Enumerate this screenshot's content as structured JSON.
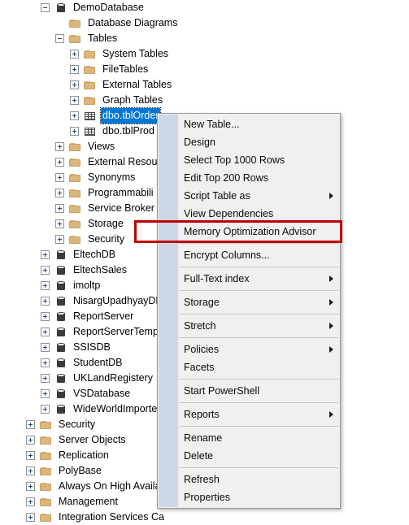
{
  "tree": {
    "name": "object-explorer-tree",
    "items": [
      {
        "label": "DemoDatabase",
        "indent": 2,
        "icon": "database-icon",
        "expander": "minus",
        "selected": false
      },
      {
        "label": "Database Diagrams",
        "indent": 3,
        "icon": "folder-icon",
        "expander": "none",
        "selected": false
      },
      {
        "label": "Tables",
        "indent": 3,
        "icon": "folder-icon",
        "expander": "minus",
        "selected": false
      },
      {
        "label": "System Tables",
        "indent": 4,
        "icon": "folder-icon",
        "expander": "plus",
        "selected": false
      },
      {
        "label": "FileTables",
        "indent": 4,
        "icon": "folder-icon",
        "expander": "plus",
        "selected": false
      },
      {
        "label": "External Tables",
        "indent": 4,
        "icon": "folder-icon",
        "expander": "plus",
        "selected": false
      },
      {
        "label": "Graph Tables",
        "indent": 4,
        "icon": "folder-icon",
        "expander": "plus",
        "selected": false
      },
      {
        "label": "dbo.tblOrder",
        "indent": 4,
        "icon": "table-icon",
        "expander": "plus",
        "selected": true
      },
      {
        "label": "dbo.tblProd",
        "indent": 4,
        "icon": "table-icon",
        "expander": "plus",
        "selected": false
      },
      {
        "label": "Views",
        "indent": 3,
        "icon": "folder-icon",
        "expander": "plus",
        "selected": false
      },
      {
        "label": "External Resour",
        "indent": 3,
        "icon": "folder-icon",
        "expander": "plus",
        "selected": false
      },
      {
        "label": "Synonyms",
        "indent": 3,
        "icon": "folder-icon",
        "expander": "plus",
        "selected": false
      },
      {
        "label": "Programmabili",
        "indent": 3,
        "icon": "folder-icon",
        "expander": "plus",
        "selected": false
      },
      {
        "label": "Service Broker",
        "indent": 3,
        "icon": "folder-icon",
        "expander": "plus",
        "selected": false
      },
      {
        "label": "Storage",
        "indent": 3,
        "icon": "folder-icon",
        "expander": "plus",
        "selected": false
      },
      {
        "label": "Security",
        "indent": 3,
        "icon": "folder-icon",
        "expander": "plus",
        "selected": false
      },
      {
        "label": "EltechDB",
        "indent": 2,
        "icon": "database-icon",
        "expander": "plus",
        "selected": false
      },
      {
        "label": "EltechSales",
        "indent": 2,
        "icon": "database-icon",
        "expander": "plus",
        "selected": false
      },
      {
        "label": "imoltp",
        "indent": 2,
        "icon": "database-icon",
        "expander": "plus",
        "selected": false
      },
      {
        "label": "NisargUpadhyayDB",
        "indent": 2,
        "icon": "database-icon",
        "expander": "plus",
        "selected": false
      },
      {
        "label": "ReportServer",
        "indent": 2,
        "icon": "database-icon",
        "expander": "plus",
        "selected": false
      },
      {
        "label": "ReportServerTempl",
        "indent": 2,
        "icon": "database-icon",
        "expander": "plus",
        "selected": false
      },
      {
        "label": "SSISDB",
        "indent": 2,
        "icon": "database-icon",
        "expander": "plus",
        "selected": false
      },
      {
        "label": "StudentDB",
        "indent": 2,
        "icon": "database-icon",
        "expander": "plus",
        "selected": false
      },
      {
        "label": "UKLandRegistery",
        "indent": 2,
        "icon": "database-icon",
        "expander": "plus",
        "selected": false
      },
      {
        "label": "VSDatabase",
        "indent": 2,
        "icon": "database-icon",
        "expander": "plus",
        "selected": false
      },
      {
        "label": "WideWorldImporte",
        "indent": 2,
        "icon": "database-icon",
        "expander": "plus",
        "selected": false
      },
      {
        "label": "Security",
        "indent": 1,
        "icon": "folder-icon",
        "expander": "plus",
        "selected": false
      },
      {
        "label": "Server Objects",
        "indent": 1,
        "icon": "folder-icon",
        "expander": "plus",
        "selected": false
      },
      {
        "label": "Replication",
        "indent": 1,
        "icon": "folder-icon",
        "expander": "plus",
        "selected": false
      },
      {
        "label": "PolyBase",
        "indent": 1,
        "icon": "folder-icon",
        "expander": "plus",
        "selected": false
      },
      {
        "label": "Always On High Availa",
        "indent": 1,
        "icon": "folder-icon",
        "expander": "plus",
        "selected": false
      },
      {
        "label": "Management",
        "indent": 1,
        "icon": "folder-icon",
        "expander": "plus",
        "selected": false
      },
      {
        "label": "Integration Services Ca",
        "indent": 1,
        "icon": "folder-icon",
        "expander": "plus",
        "selected": false
      }
    ]
  },
  "context_menu": {
    "name": "table-context-menu",
    "highlight_color": "#c00000",
    "items": [
      {
        "label": "New Table...",
        "submenu": false,
        "separator_after": false,
        "highlighted": false
      },
      {
        "label": "Design",
        "submenu": false,
        "separator_after": false,
        "highlighted": false
      },
      {
        "label": "Select Top 1000 Rows",
        "submenu": false,
        "separator_after": false,
        "highlighted": false
      },
      {
        "label": "Edit Top 200 Rows",
        "submenu": false,
        "separator_after": false,
        "highlighted": false
      },
      {
        "label": "Script Table as",
        "submenu": true,
        "separator_after": false,
        "highlighted": false
      },
      {
        "label": "View Dependencies",
        "submenu": false,
        "separator_after": false,
        "highlighted": false
      },
      {
        "label": "Memory Optimization Advisor",
        "submenu": false,
        "separator_after": true,
        "highlighted": true
      },
      {
        "label": "Encrypt Columns...",
        "submenu": false,
        "separator_after": true,
        "highlighted": false
      },
      {
        "label": "Full-Text index",
        "submenu": true,
        "separator_after": true,
        "highlighted": false
      },
      {
        "label": "Storage",
        "submenu": true,
        "separator_after": true,
        "highlighted": false
      },
      {
        "label": "Stretch",
        "submenu": true,
        "separator_after": true,
        "highlighted": false
      },
      {
        "label": "Policies",
        "submenu": true,
        "separator_after": false,
        "highlighted": false
      },
      {
        "label": "Facets",
        "submenu": false,
        "separator_after": true,
        "highlighted": false
      },
      {
        "label": "Start PowerShell",
        "submenu": false,
        "separator_after": true,
        "highlighted": false
      },
      {
        "label": "Reports",
        "submenu": true,
        "separator_after": true,
        "highlighted": false
      },
      {
        "label": "Rename",
        "submenu": false,
        "separator_after": false,
        "highlighted": false
      },
      {
        "label": "Delete",
        "submenu": false,
        "separator_after": true,
        "highlighted": false
      },
      {
        "label": "Refresh",
        "submenu": false,
        "separator_after": false,
        "highlighted": false
      },
      {
        "label": "Properties",
        "submenu": false,
        "separator_after": false,
        "highlighted": false
      }
    ]
  }
}
